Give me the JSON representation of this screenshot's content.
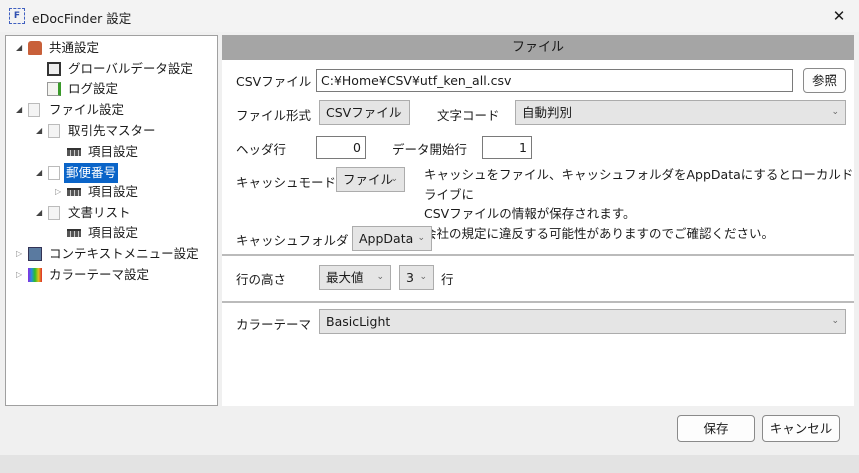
{
  "window": {
    "title": "eDocFinder 設定",
    "icon_letter": "F"
  },
  "tree": [
    {
      "label": "共通設定",
      "icon": "house-icon"
    },
    {
      "label": "グローバルデータ設定",
      "icon": "server-icon"
    },
    {
      "label": "ログ設定",
      "icon": "notepad-icon"
    },
    {
      "label": "ファイル設定",
      "icon": "document-icon"
    },
    {
      "label": "取引先マスター",
      "icon": "document-icon"
    },
    {
      "label": "項目設定",
      "icon": "grid-icon"
    },
    {
      "label": "郵便番号",
      "icon": "document-icon",
      "selected": true
    },
    {
      "label": "項目設定",
      "icon": "grid-icon"
    },
    {
      "label": "文書リスト",
      "icon": "document-icon"
    },
    {
      "label": "項目設定",
      "icon": "grid-icon"
    },
    {
      "label": "コンテキストメニュー設定",
      "icon": "menu-icon"
    },
    {
      "label": "カラーテーマ設定",
      "icon": "palette-icon"
    }
  ],
  "panel": {
    "header": "ファイル",
    "csv_file_label": "CSVファイル",
    "csv_file_value": "C:¥Home¥CSV¥utf_ken_all.csv",
    "browse": "参照",
    "file_format_label": "ファイル形式",
    "file_format_value": "CSVファイル",
    "encoding_label": "文字コード",
    "encoding_value": "自動判別",
    "header_row_label": "ヘッダ行",
    "header_row_value": "0",
    "data_start_label": "データ開始行",
    "data_start_value": "1",
    "cache_mode_label": "キャッシュモード",
    "cache_mode_value": "ファイル",
    "note": [
      "キャッシュをファイル、キャッシュフォルダをAppDataにするとローカルドライブに",
      "CSVファイルの情報が保存されます。",
      "会社の規定に違反する可能性がありますのでご確認ください。"
    ],
    "cache_folder_label": "キャッシュフォルダ",
    "cache_folder_value": "AppData",
    "row_height_label": "行の高さ",
    "row_height_mode": "最大値",
    "row_height_count": "3",
    "row_height_unit": "行",
    "color_theme_label": "カラーテーマ",
    "color_theme_value": "BasicLight"
  },
  "footer": {
    "save": "保存",
    "cancel": "キャンセル"
  }
}
